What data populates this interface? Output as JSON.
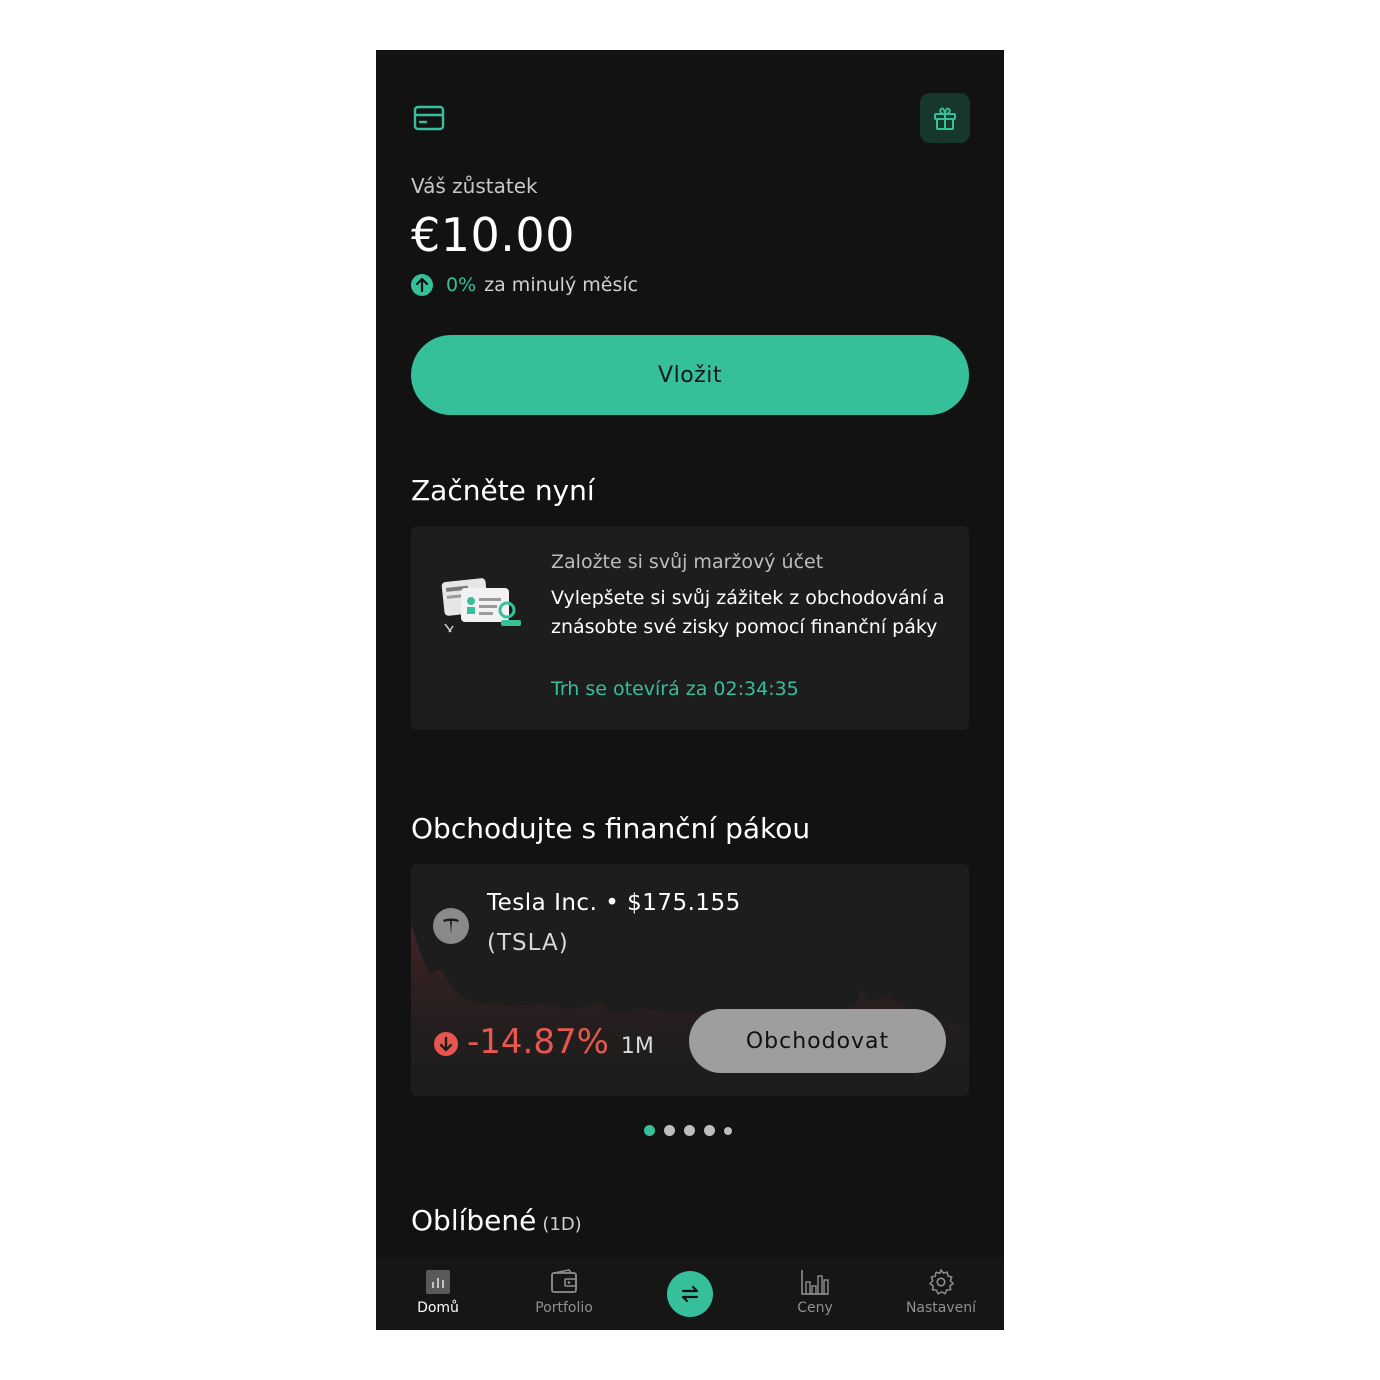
{
  "header": {
    "card_icon": "credit-card-icon",
    "gift_icon": "gift-icon"
  },
  "balance": {
    "label": "Váš zůstatek",
    "value": "€10.00",
    "change_pct": "0%",
    "change_text": "za minulý měsíc"
  },
  "deposit_button": "Vložit",
  "start": {
    "title": "Začněte nyní",
    "card_small": "Založte si svůj maržový účet",
    "card_desc": "Vylepšete si svůj zážitek z obchodování a znásobte své zisky pomocí finanční páky",
    "card_timer": "Trh se otevírá za 02:34:35"
  },
  "leverage": {
    "title": "Obchodujte s finanční pákou",
    "stock_name": "Tesla Inc. • $175.155",
    "stock_ticker": "(TSLA)",
    "change_pct": "-14.87%",
    "period": "1M",
    "trade_button": "Obchodovat"
  },
  "carousel": {
    "count": 5,
    "active_index": 0
  },
  "favorites": {
    "title": "Oblíbené",
    "subtitle": "(1D)"
  },
  "nav": {
    "items": [
      {
        "label": "Domů",
        "icon": "home-chart-icon"
      },
      {
        "label": "Portfolio",
        "icon": "wallet-icon"
      },
      {
        "label": "",
        "icon": "swap-arrows-icon"
      },
      {
        "label": "Ceny",
        "icon": "bar-chart-icon"
      },
      {
        "label": "Nastavení",
        "icon": "settings-gear-icon"
      }
    ]
  },
  "colors": {
    "accent": "#36bf9b",
    "negative": "#e8574f",
    "background": "#121212",
    "card": "#1d1d1d"
  }
}
